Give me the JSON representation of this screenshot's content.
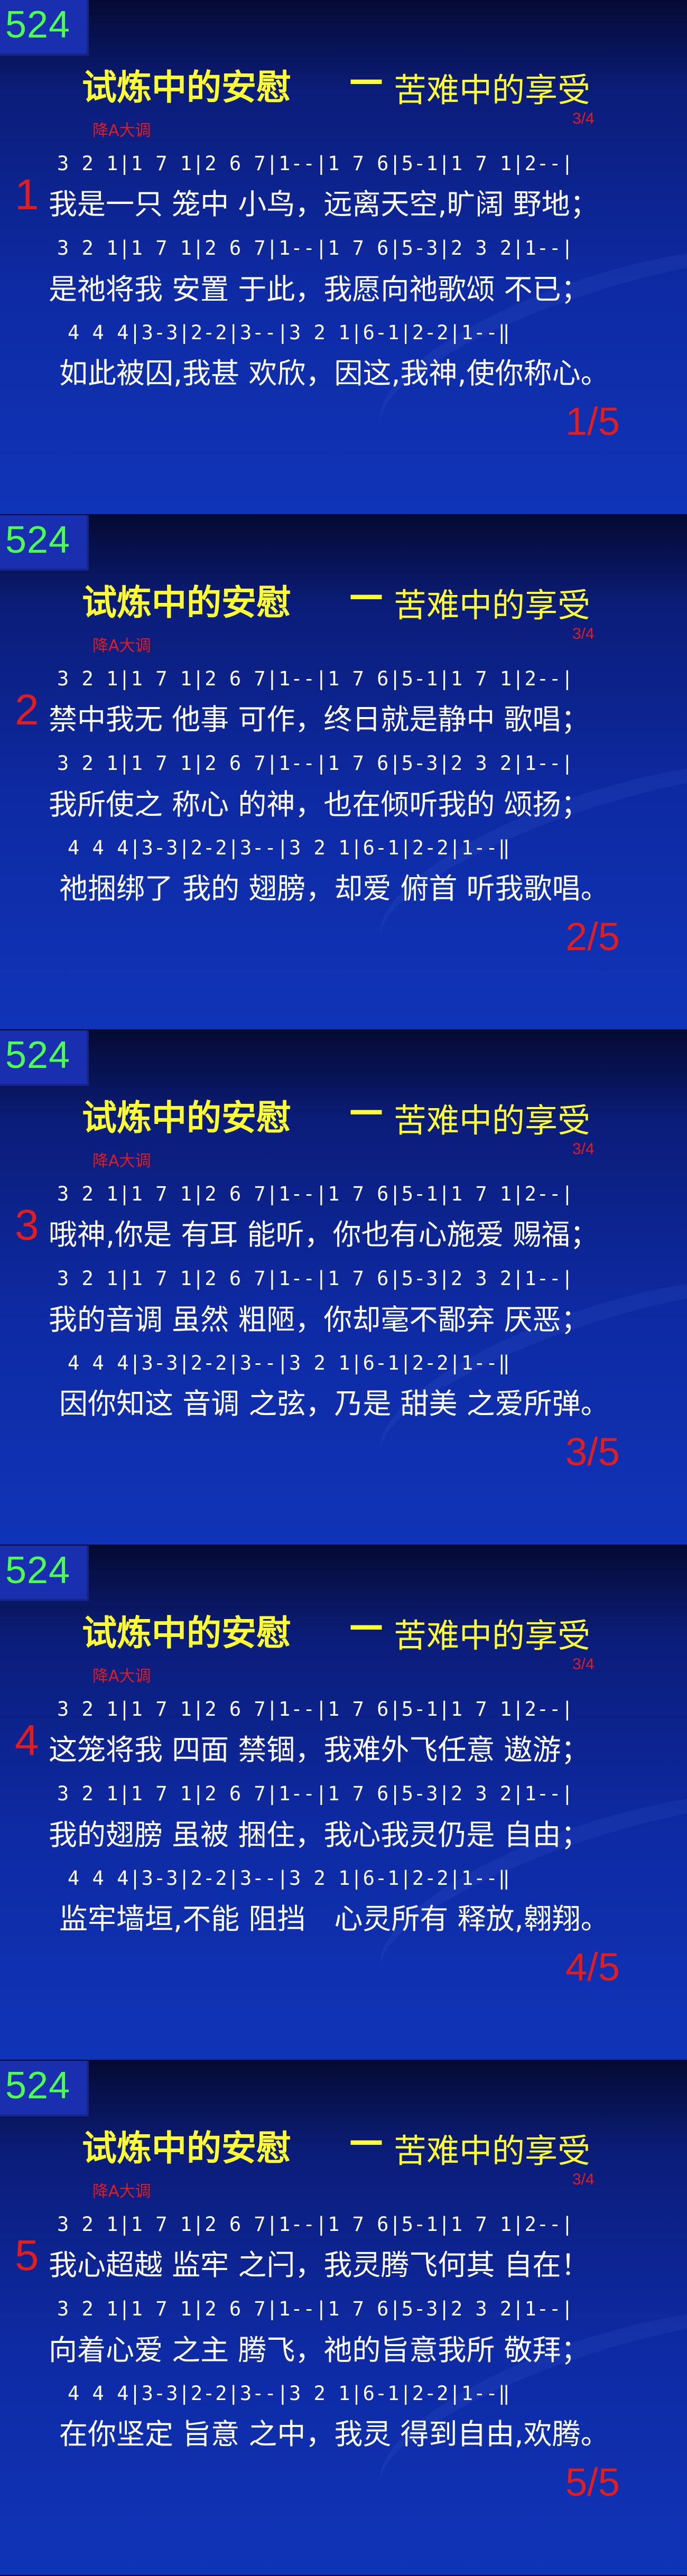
{
  "hymn_number": "524",
  "title": "试炼中的安慰",
  "dash": "—",
  "subtitle": "苦难中的享受",
  "key": "降A大调",
  "time_signature": "3/4",
  "notation": {
    "line1": "3 2 1|1 7 1|2 6 7|1--|1 7 6|5-1|1 7 1|2--|",
    "line2": "3 2 1|1 7 1|2 6 7|1--|1 7 6|5-3|2 3 2|1--|",
    "line3": "4 4 4|3-3|2-2|3--|3 2 1|6-1|2-2|1--‖"
  },
  "slides": [
    {
      "verse": "1",
      "page": "1/5",
      "lyrics": [
        "我是一只 笼中 小鸟，远离天空,旷阔 野地；",
        "是祂将我 安置 于此，我愿向祂歌颂 不已；",
        "如此被囚,我甚 欢欣，因这,我神,使你称心。"
      ]
    },
    {
      "verse": "2",
      "page": "2/5",
      "lyrics": [
        "禁中我无 他事 可作，终日就是静中 歌唱；",
        "我所使之 称心 的神，也在倾听我的 颂扬；",
        "祂捆绑了 我的 翅膀，却爱 俯首 听我歌唱。"
      ]
    },
    {
      "verse": "3",
      "page": "3/5",
      "lyrics": [
        "哦神,你是 有耳 能听，你也有心施爱 赐福；",
        "我的音调 虽然 粗陋，你却毫不鄙弃 厌恶；",
        "因你知这 音调 之弦，乃是 甜美 之爱所弹。"
      ]
    },
    {
      "verse": "4",
      "page": "4/5",
      "lyrics": [
        "这笼将我 四面 禁锢，我难外飞任意 遨游；",
        "我的翅膀 虽被 捆住，我心我灵仍是 自由；",
        "监牢墙垣,不能 阻挡　心灵所有 释放,翱翔。"
      ]
    },
    {
      "verse": "5",
      "page": "5/5",
      "lyrics": [
        "我心超越 监牢 之闩，我灵腾飞何其 自在！",
        "向着心爱 之主 腾飞，祂的旨意我所 敬拜；",
        "在你坚定 旨意 之中，我灵 得到自由,欢腾。"
      ]
    }
  ]
}
